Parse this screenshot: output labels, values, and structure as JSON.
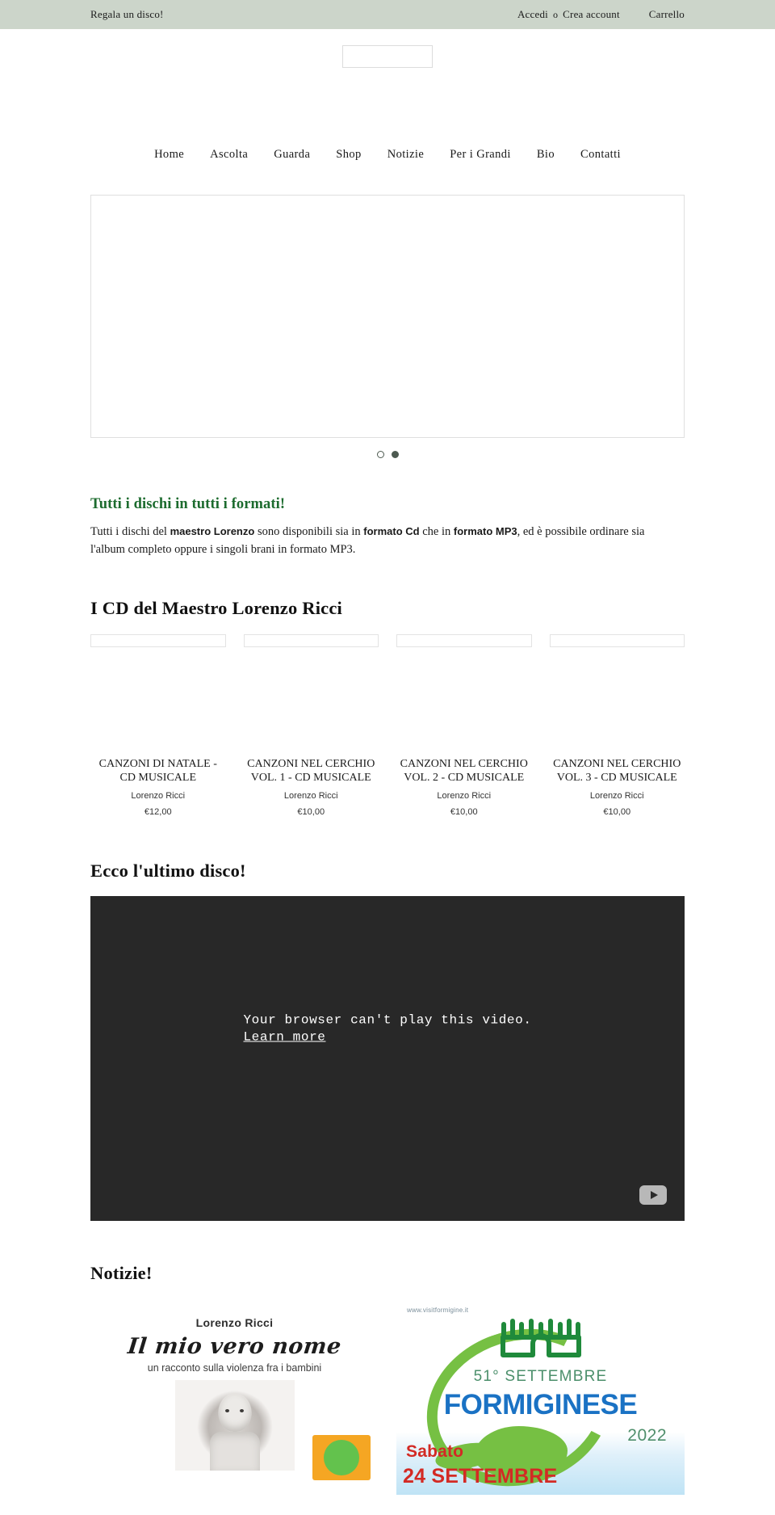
{
  "topbar": {
    "promo": "Regala un disco!",
    "login": "Accedi",
    "or": "o",
    "create_account": "Crea account",
    "cart": "Carrello"
  },
  "nav": {
    "items": [
      {
        "label": "Home"
      },
      {
        "label": "Ascolta"
      },
      {
        "label": "Guarda"
      },
      {
        "label": "Shop"
      },
      {
        "label": "Notizie"
      },
      {
        "label": "Per i Grandi"
      },
      {
        "label": "Bio"
      },
      {
        "label": "Contatti"
      }
    ]
  },
  "slider": {
    "dots": [
      {
        "active": false
      },
      {
        "active": true
      }
    ]
  },
  "intro": {
    "heading": "Tutti i dischi in tutti i formati!",
    "par_a": "Tutti i dischi del ",
    "par_b": "maestro Lorenzo",
    "par_c": " sono disponibili sia in ",
    "par_d": "formato Cd",
    "par_e": " che in ",
    "par_f": "formato MP3",
    "par_g": ", ed è possibile ordinare sia l'album completo oppure i singoli brani in formato MP3."
  },
  "products_section": {
    "title": "I CD del Maestro Lorenzo Ricci",
    "items": [
      {
        "title": "CANZONI DI NATALE - CD MUSICALE",
        "vendor": "Lorenzo Ricci",
        "price": "€12,00"
      },
      {
        "title": "CANZONI NEL CERCHIO VOL. 1 - CD MUSICALE",
        "vendor": "Lorenzo Ricci",
        "price": "€10,00"
      },
      {
        "title": "CANZONI NEL CERCHIO VOL. 2 - CD MUSICALE",
        "vendor": "Lorenzo Ricci",
        "price": "€10,00"
      },
      {
        "title": "CANZONI NEL CERCHIO VOL. 3 - CD MUSICALE",
        "vendor": "Lorenzo Ricci",
        "price": "€10,00"
      }
    ]
  },
  "video_section": {
    "title": "Ecco l'ultimo disco!",
    "error_message": "Your browser can't play this video.",
    "learn_more": "Learn more",
    "play_icon": "play-icon"
  },
  "news_section": {
    "title": "Notizie!",
    "items": [
      {
        "type": "book-cover",
        "author": "Lorenzo Ricci",
        "title": "Il mio vero nome",
        "subtitle": "un racconto sulla violenza fra i bambini"
      },
      {
        "type": "event-poster",
        "url": "www.visitformigine.it",
        "line1": "51° SETTEMBRE",
        "line2": "FORMIGINESE",
        "year": "2022",
        "weekday": "Sabato",
        "date": "24 SETTEMBRE"
      }
    ]
  },
  "colors": {
    "topbar_bg": "#ccd5ca",
    "green_heading": "#1c6b2e",
    "video_bg": "#282828",
    "poster_blue": "#1a72c4",
    "poster_green": "#76c043",
    "poster_red": "#d32a24"
  }
}
